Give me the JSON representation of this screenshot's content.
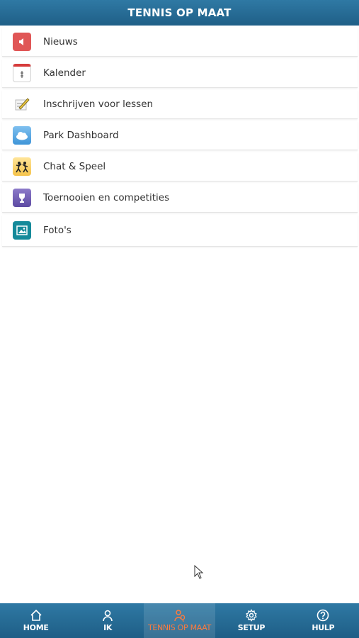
{
  "header": {
    "title": "TENNIS OP MAAT"
  },
  "menu": [
    {
      "label": "Nieuws",
      "icon": "megaphone-icon"
    },
    {
      "label": "Kalender",
      "icon": "calendar-icon"
    },
    {
      "label": "Inschrijven voor lessen",
      "icon": "pen-icon"
    },
    {
      "label": "Park Dashboard",
      "icon": "weather-cloud-icon"
    },
    {
      "label": "Chat & Speel",
      "icon": "players-chat-icon"
    },
    {
      "label": "Toernooien en competities",
      "icon": "trophy-icon"
    },
    {
      "label": "Foto's",
      "icon": "photo-icon"
    }
  ],
  "navbar": {
    "items": [
      {
        "label": "HOME",
        "icon": "home-icon"
      },
      {
        "label": "IK",
        "icon": "user-icon"
      },
      {
        "label": "TENNIS OP MAAT",
        "icon": "tennis-player-icon",
        "active": true
      },
      {
        "label": "SETUP",
        "icon": "gear-icon"
      },
      {
        "label": "HULP",
        "icon": "help-icon"
      }
    ]
  },
  "colors": {
    "header_bg": "#2a7099",
    "active_nav": "#ff7a3c",
    "background": "#ffffff"
  }
}
